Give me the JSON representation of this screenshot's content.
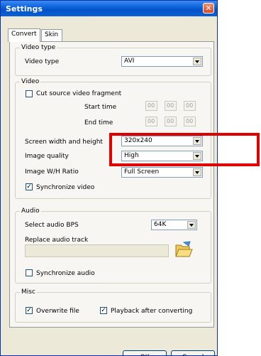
{
  "window": {
    "title": "Settings"
  },
  "tabs": [
    {
      "label": "Convert"
    },
    {
      "label": "Skin"
    }
  ],
  "video_type": {
    "group_label": "Video type",
    "label": "Video type",
    "value": "AVI"
  },
  "video": {
    "group_label": "Video",
    "cut_label": "Cut source video fragment",
    "cut_checked": false,
    "start_label": "Start time",
    "end_label": "End time",
    "start_time": [
      "00",
      "00",
      "00"
    ],
    "end_time": [
      "00",
      "00",
      "00"
    ],
    "screen_label": "Screen width and height",
    "screen_value": "320x240",
    "quality_label": "Image quality",
    "quality_value": "High",
    "ratio_label": "Image W/H Ratio",
    "ratio_value": "Full Screen",
    "sync_label": "Synchronize video",
    "sync_checked": true
  },
  "audio": {
    "group_label": "Audio",
    "bps_label": "Select audio BPS",
    "bps_value": "64K",
    "replace_label": "Replace audio track",
    "replace_value": "",
    "sync_label": "Synchronize audio",
    "sync_checked": false
  },
  "misc": {
    "group_label": "Misc",
    "overwrite_label": "Overwrite file",
    "overwrite_checked": true,
    "playback_label": "Playback after converting",
    "playback_checked": true
  },
  "buttons": {
    "ok": "OK",
    "cancel": "Cancel"
  },
  "colors": {
    "highlight": "#e00000",
    "titlebar": "#0a5fd8"
  },
  "icons": {
    "folder": "open-folder-icon",
    "close": "close-icon"
  }
}
